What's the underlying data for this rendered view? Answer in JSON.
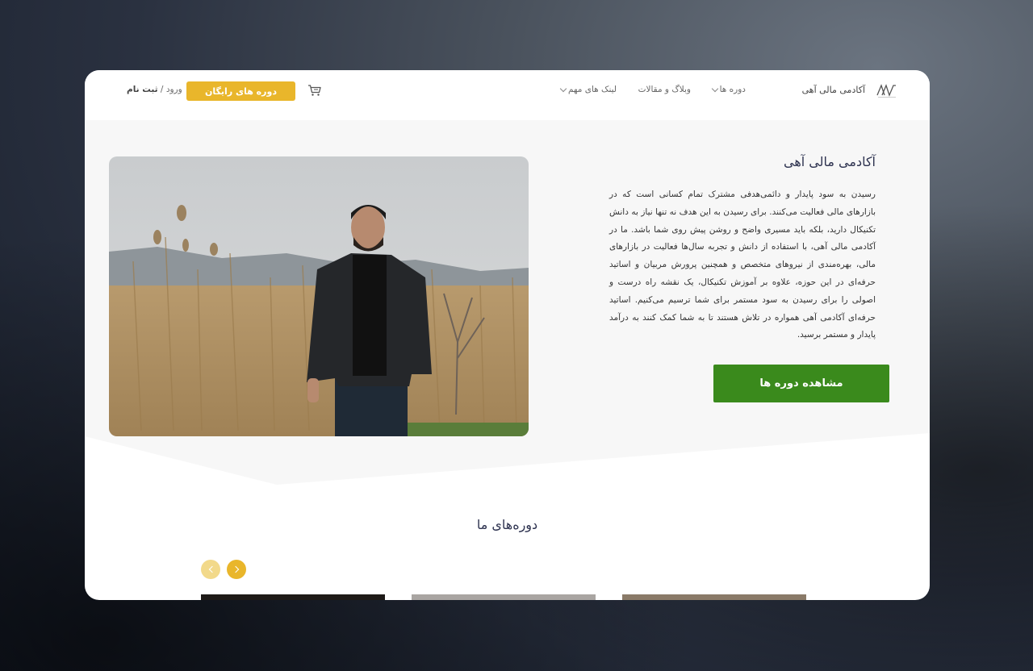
{
  "header": {
    "site_name": "آکادمی مالی آهی",
    "nav": [
      {
        "label": "دوره ها",
        "dropdown": true
      },
      {
        "label": "وبلاگ و مقالات",
        "dropdown": false
      },
      {
        "label": "لینک های مهم",
        "dropdown": true
      }
    ],
    "free_courses_label": "دوره های رایگان",
    "login_label": "ورود",
    "auth_separator": " / ",
    "register_label": "ثبت نام"
  },
  "hero": {
    "title": "آکادمی مالی آهی",
    "description": "رسیدن به سود پایدار و دائمی‌هدفی مشترک تمام کسانی است که در بازارهای مالی فعالیت می‌کنند. برای رسیدن به این هدف نه تنها نیاز به دانش تکنیکال دارید، بلکه باید مسیری واضح و روشن پیش روی شما باشد. ما در آکادمی مالی آهی، با استفاده از دانش و تجربه سال‌ها فعالیت در بازارهای مالی، بهره‌مندی از نیروهای متخصص و همچنین پرورش مربیان و اساتید حرفه‌ای در این حوزه، علاوه بر آموزش تکنیکال، یک نقشه راه درست و اصولی را برای رسیدن به سود مستمر برای شما ترسیم می‌کنیم. اساتید حرفه‌ای آکادمی آهی همواره در تلاش هستند تا به شما کمک کنند به درآمد پایدار و مستمر برسید.",
    "cta_label": "مشاهده دوره ها"
  },
  "courses": {
    "title": "دوره‌های ما"
  },
  "colors": {
    "accent": "#e9b62b",
    "cta": "#3a8a1c",
    "title": "#2e3350"
  }
}
